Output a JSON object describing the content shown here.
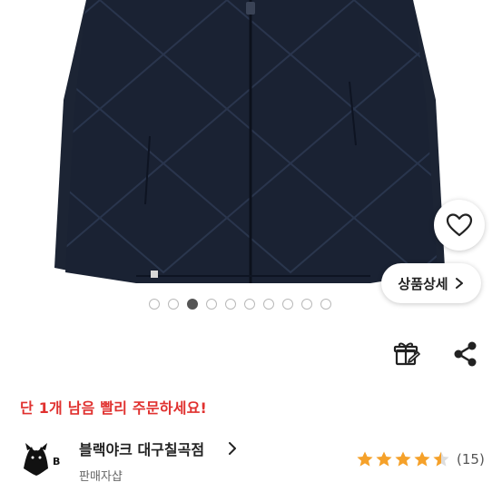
{
  "gallery": {
    "image_subject": "navy quilted down jacket",
    "page_count": 10,
    "active_index": 2
  },
  "wishlist": {
    "icon": "heart-outline-icon"
  },
  "detail_button": {
    "label": "상품상세",
    "icon": "chevron-right-icon"
  },
  "actions": {
    "gift_icon": "gift-icon",
    "share_icon": "share-icon"
  },
  "stock_notice": "단 1개 남음 빨리 주문하세요!",
  "seller": {
    "name": "블랙야크 대구칠곡점",
    "type": "판매자샵",
    "logo_letter": "B"
  },
  "rating": {
    "score": 4.5,
    "max": 5,
    "review_count_label": "(15)"
  },
  "colors": {
    "notice_red": "#e0312f",
    "star_orange": "#f5a12a",
    "jacket_navy": "#1a2233"
  }
}
